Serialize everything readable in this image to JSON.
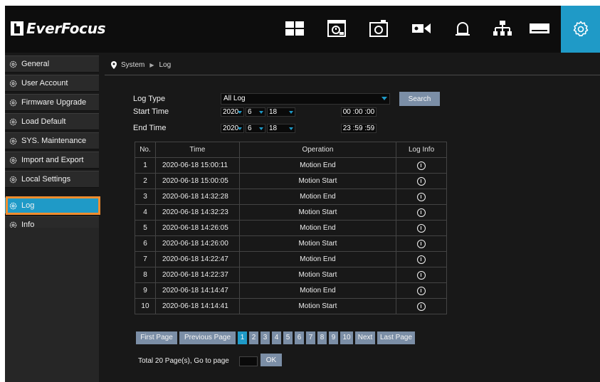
{
  "brand": {
    "name": "EverFocus"
  },
  "top_nav": {
    "icons": [
      "multiview-icon",
      "playback-icon",
      "snapshot-icon",
      "record-icon",
      "alarm-icon",
      "network-icon",
      "storage-icon",
      "settings-icon"
    ],
    "accent_color": "#1f9ac7"
  },
  "breadcrumb": {
    "root": "System",
    "current": "Log"
  },
  "sidebar": {
    "items": [
      {
        "label": "General"
      },
      {
        "label": "User Account"
      },
      {
        "label": "Firmware Upgrade"
      },
      {
        "label": "Load Default"
      },
      {
        "label": "SYS. Maintenance"
      },
      {
        "label": "Import and Export"
      },
      {
        "label": "Local Settings"
      },
      {
        "label": "Log",
        "active": true
      },
      {
        "label": "Info"
      }
    ]
  },
  "form": {
    "log_type_label": "Log Type",
    "log_type_value": "All Log",
    "search_label": "Search",
    "start_time_label": "Start Time",
    "start_year": "2020",
    "start_month": "6",
    "start_day": "18",
    "start_clock": "00 :00 :00",
    "end_time_label": "End Time",
    "end_year": "2020",
    "end_month": "6",
    "end_day": "18",
    "end_clock": "23 :59 :59"
  },
  "table": {
    "headers": {
      "no": "No.",
      "time": "Time",
      "operation": "Operation",
      "info": "Log Info"
    },
    "rows": [
      {
        "no": "1",
        "time": "2020-06-18 15:00:11",
        "operation": "Motion End"
      },
      {
        "no": "2",
        "time": "2020-06-18 15:00:05",
        "operation": "Motion Start"
      },
      {
        "no": "3",
        "time": "2020-06-18 14:32:28",
        "operation": "Motion End"
      },
      {
        "no": "4",
        "time": "2020-06-18 14:32:23",
        "operation": "Motion Start"
      },
      {
        "no": "5",
        "time": "2020-06-18 14:26:05",
        "operation": "Motion End"
      },
      {
        "no": "6",
        "time": "2020-06-18 14:26:00",
        "operation": "Motion Start"
      },
      {
        "no": "7",
        "time": "2020-06-18 14:22:47",
        "operation": "Motion End"
      },
      {
        "no": "8",
        "time": "2020-06-18 14:22:37",
        "operation": "Motion Start"
      },
      {
        "no": "9",
        "time": "2020-06-18 14:14:47",
        "operation": "Motion End"
      },
      {
        "no": "10",
        "time": "2020-06-18 14:14:41",
        "operation": "Motion Start"
      }
    ]
  },
  "pager": {
    "first": "First Page",
    "previous": "Previous Page",
    "pages": [
      "1",
      "2",
      "3",
      "4",
      "5",
      "6",
      "7",
      "8",
      "9",
      "10"
    ],
    "current_page": "1",
    "next": "Next",
    "last": "Last Page",
    "goto_label": "Total 20 Page(s), Go to page",
    "ok": "OK"
  }
}
